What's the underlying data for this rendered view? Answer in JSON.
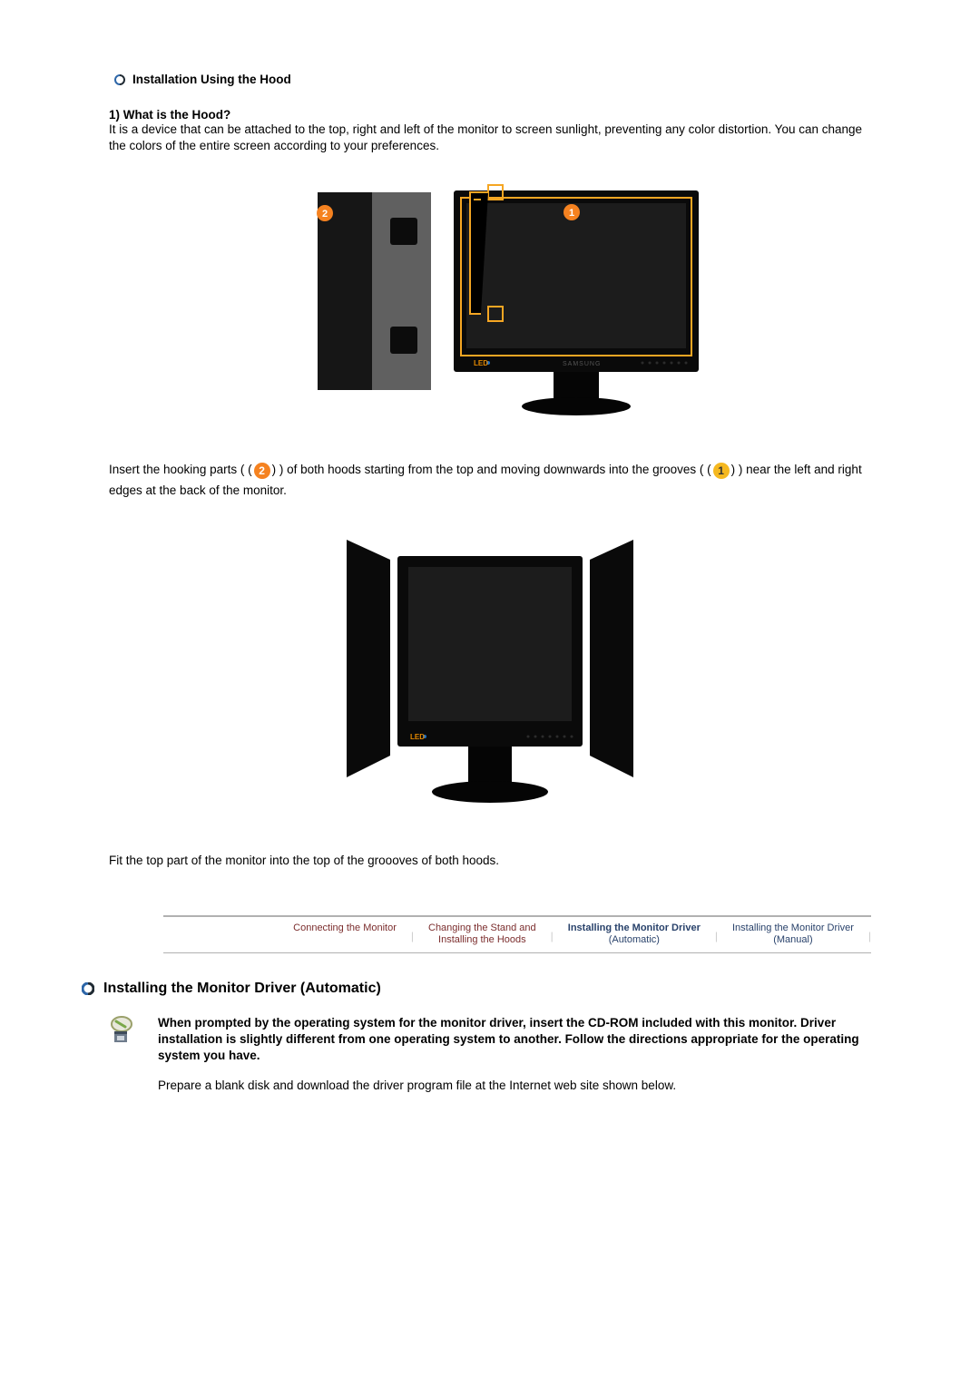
{
  "section1": {
    "title": "Installation Using the Hood",
    "sub1_heading": "1) What is the Hood?",
    "sub1_body": "It is a device that can be attached to the top, right and left of the monitor to screen sunlight, preventing any color distortion. You can change the colors of the entire screen according to your preferences.",
    "insert_a": "Insert the hooking parts (",
    "insert_b": ") of both hoods starting from the top and moving downwards into the grooves (",
    "insert_c": ") near the left and right edges at the back of the monitor.",
    "badge2": "2",
    "badge1": "1",
    "fit_line": "Fit the top part of the monitor into the top of the groooves of both hoods."
  },
  "figure1": {
    "callout_n1": "1",
    "callout_n2": "2",
    "led_label": "LED",
    "brand": "SAMSUNG"
  },
  "nav": {
    "a": "Connecting  the Monitor",
    "b1": "Changing the Stand and",
    "b2": "Installing the Hoods",
    "c1": "Installing the Monitor Driver",
    "c2": "(Automatic)",
    "d1": "Installing the Monitor Driver",
    "d2": "(Manual)"
  },
  "section2": {
    "title": "Installing the Monitor Driver (Automatic)",
    "prompt_bold": "When prompted by the operating system for the monitor driver, insert the CD-ROM included with this monitor. Driver installation is slightly different from one operating system to another. Follow the directions appropriate for the operating system you have.",
    "prepare": "Prepare a blank disk and download the driver program file at the Internet web site shown below."
  }
}
